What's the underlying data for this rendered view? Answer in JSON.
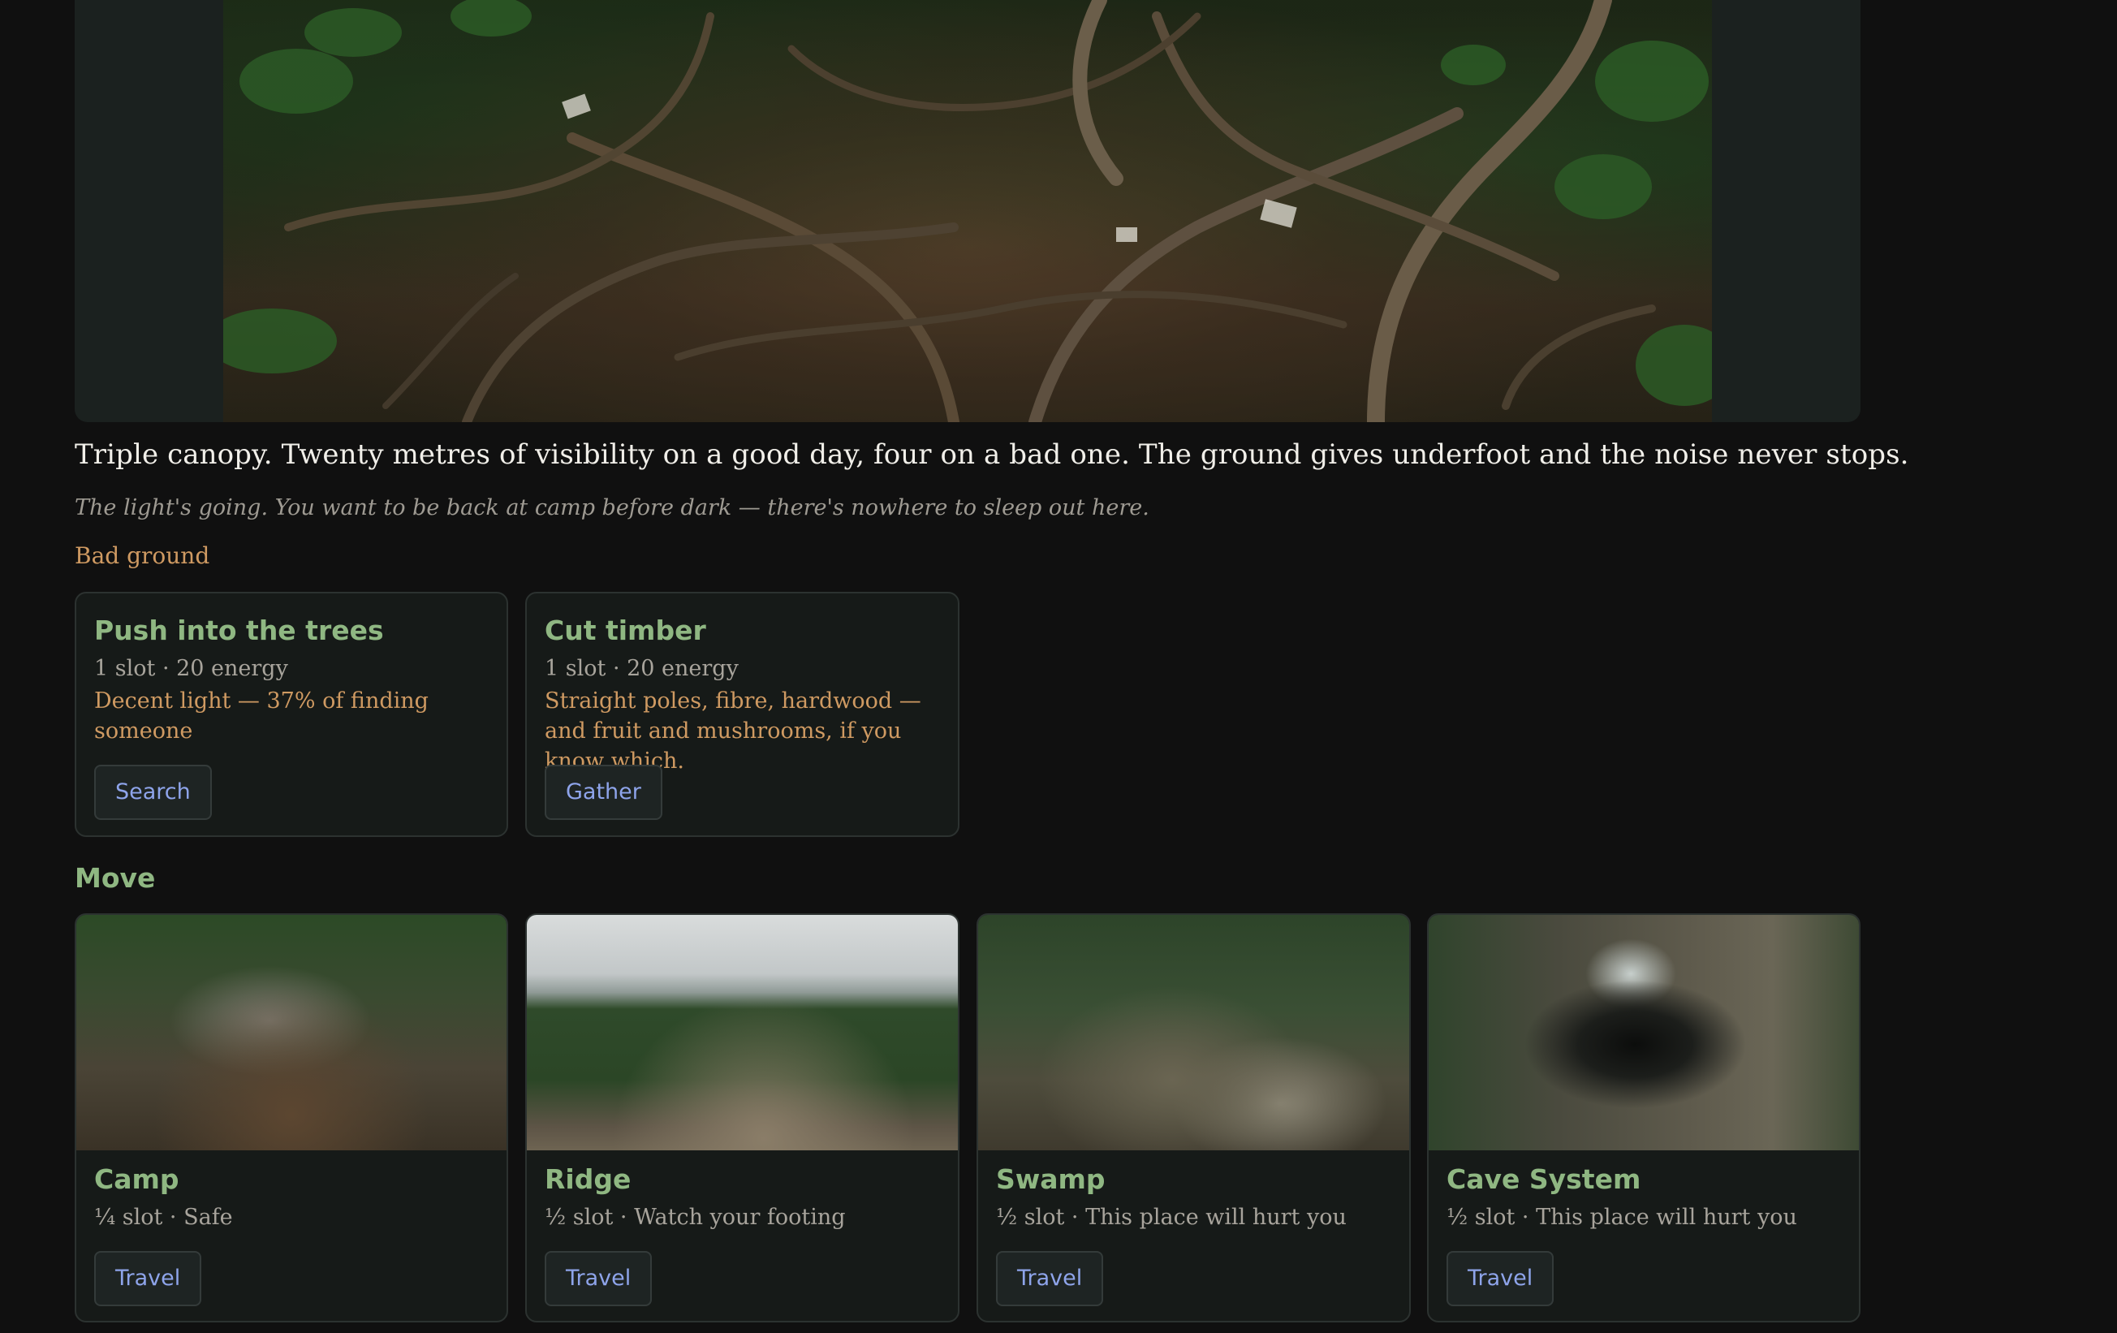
{
  "location": {
    "description": "Triple canopy. Twenty metres of visibility on a good day, four on a bad one. The ground gives underfoot and the noise never stops.",
    "warning": "The light's going. You want to be back at camp before dark — there's nowhere to sleep out here.",
    "ground_label": "Bad ground"
  },
  "actions": [
    {
      "title": "Push into the trees",
      "meta": "1 slot · 20 energy",
      "note": "Decent light — 37% of finding someone",
      "button": "Search"
    },
    {
      "title": "Cut timber",
      "meta": "1 slot · 20 energy",
      "note": "Straight poles, fibre, hardwood — and fruit and mushrooms, if you know which.",
      "button": "Gather"
    }
  ],
  "move": {
    "title": "Move",
    "destinations": [
      {
        "name": "Camp",
        "meta": "¼ slot · Safe",
        "button": "Travel"
      },
      {
        "name": "Ridge",
        "meta": "½ slot · Watch your footing",
        "button": "Travel"
      },
      {
        "name": "Swamp",
        "meta": "½ slot · This place will hurt you",
        "button": "Travel"
      },
      {
        "name": "Cave System",
        "meta": "½ slot · This place will hurt you",
        "button": "Travel"
      }
    ]
  },
  "colors": {
    "background": "#101010",
    "card": "#161a18",
    "accent_green": "#8fb782",
    "accent_orange": "#cf9a62",
    "button_text": "#8ea4ea"
  }
}
